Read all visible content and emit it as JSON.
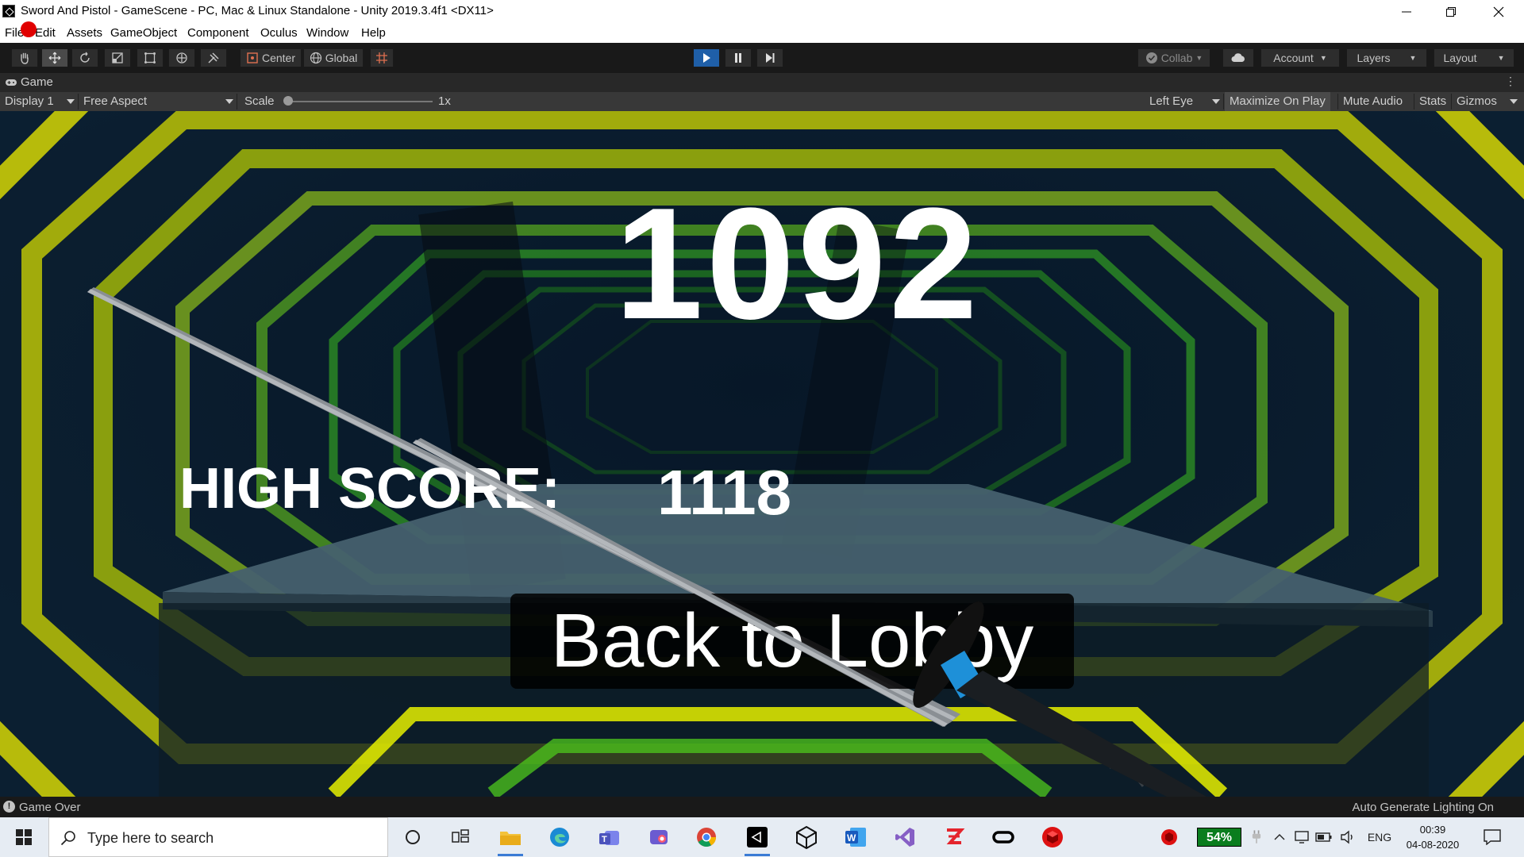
{
  "window": {
    "title": "Sword And Pistol - GameScene - PC, Mac & Linux Standalone - Unity 2019.3.4f1 <DX11>"
  },
  "menu": [
    "File",
    "Edit",
    "Assets",
    "GameObject",
    "Component",
    "Oculus",
    "Window",
    "Help"
  ],
  "toolbar": {
    "pivot_label": "Center",
    "space_label": "Global",
    "collab_label": "Collab",
    "account_label": "Account",
    "layers_label": "Layers",
    "layout_label": "Layout"
  },
  "game_tab": {
    "label": "Game"
  },
  "game_toolbar": {
    "display": "Display 1",
    "aspect": "Free Aspect",
    "scale_label": "Scale",
    "scale_value": "1x",
    "eye": "Left Eye",
    "maximize": "Maximize On Play",
    "mute": "Mute Audio",
    "stats": "Stats",
    "gizmos": "Gizmos"
  },
  "game": {
    "score": "1092",
    "high_score_label": "HIGH SCORE:",
    "high_score_value": "1118",
    "lobby_button": "Back to Lobby"
  },
  "status": {
    "message": "Game Over",
    "right": "Auto Generate Lighting On"
  },
  "taskbar": {
    "search_placeholder": "Type here to search",
    "battery": "54%",
    "language": "ENG",
    "time": "00:39",
    "date": "04-08-2020"
  },
  "colors": {
    "accent_play": "#1f5fa8",
    "neon_yellow": "#f0f000",
    "neon_green": "#33d61c",
    "battery_green": "#0a7d1e"
  }
}
